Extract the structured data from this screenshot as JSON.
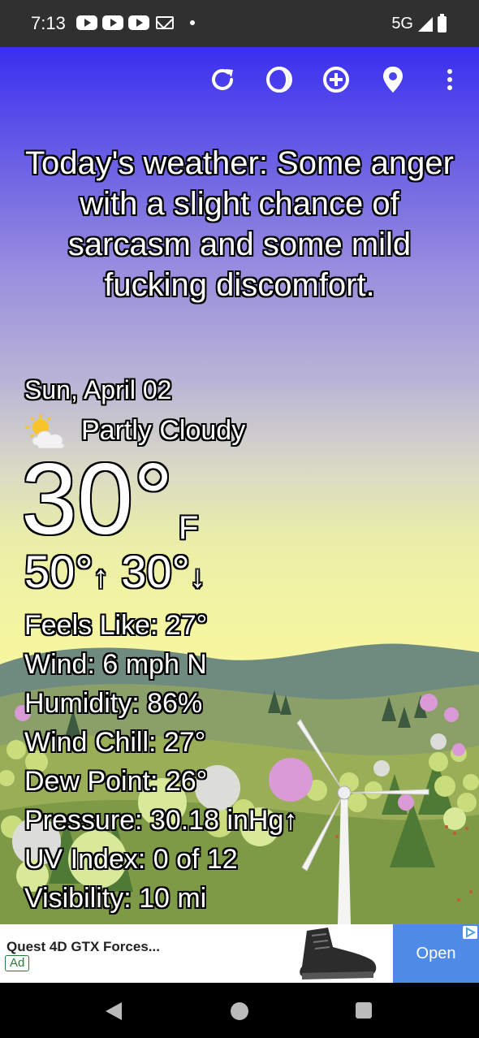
{
  "status_bar": {
    "time": "7:13",
    "network": "5G",
    "icons": [
      "youtube-icon",
      "youtube-icon",
      "youtube-icon",
      "gmail-icon",
      "dot-icon",
      "signal-icon",
      "battery-icon"
    ]
  },
  "toolbar": {
    "icons": [
      "refresh-icon",
      "theme-icon",
      "add-location-icon",
      "location-pin-icon",
      "more-vert-icon"
    ]
  },
  "message": "Today's weather: Some anger with a slight chance of sarcasm and some mild fucking discomfort.",
  "weather": {
    "date": "Sun, April 02",
    "condition": "Partly Cloudy",
    "condition_icon": "partly-cloudy-icon",
    "temperature": "30°",
    "unit": "F",
    "high": "50°",
    "low": "30°",
    "high_arrow": "↑",
    "low_arrow": "↓",
    "details": [
      "Feels Like:  27°",
      "Wind:  6 mph N",
      "Humidity:  86%",
      "Wind Chill:  27°",
      "Dew Point:  26°",
      "Pressure:  30.18 inHg↑",
      "UV Index:  0 of 12",
      "Visibility:  10 mi"
    ]
  },
  "ad": {
    "title": "Quest 4D GTX Forces...",
    "badge": "Ad",
    "cta": "Open"
  },
  "colors": {
    "sky_top": "#3a2ff0",
    "sky_bottom": "#f8f49c",
    "ad_button": "#4f8ae6"
  }
}
